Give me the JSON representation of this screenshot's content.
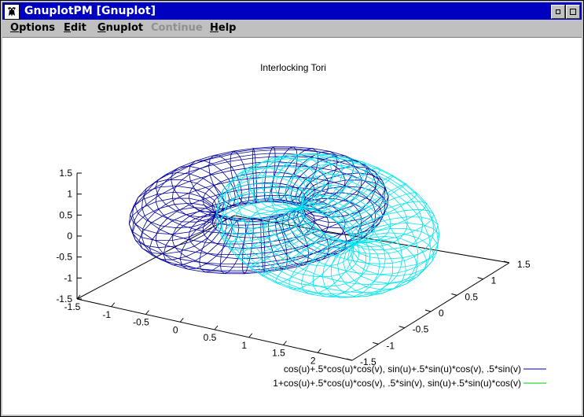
{
  "window": {
    "title": "GnuplotPM [Gnuplot]"
  },
  "menu": {
    "items": [
      {
        "first": "O",
        "rest": "ptions",
        "enabled": true
      },
      {
        "first": "E",
        "rest": "dit",
        "enabled": true
      },
      {
        "first": "G",
        "rest": "nuplot",
        "enabled": true
      },
      {
        "first": "",
        "rest": "Continue",
        "enabled": false
      },
      {
        "first": "H",
        "rest": "elp",
        "enabled": true
      }
    ]
  },
  "colors": {
    "series1": "#000099",
    "series2": "#00e5ee",
    "legend2": "#00cc00"
  },
  "chart_data": {
    "type": "surface3d",
    "title": "Interlocking Tori",
    "z_ticks": [
      "1.5",
      "1",
      "0.5",
      "0",
      "-0.5",
      "-1",
      "-1.5"
    ],
    "x_ticks": [
      "-1.5",
      "-1",
      "-0.5",
      "0",
      "0.5",
      "1",
      "1.5",
      "2"
    ],
    "y_ticks": [
      "-1.5",
      "-1",
      "-0.5",
      "0",
      "0.5",
      "1",
      "1.5"
    ],
    "xlim": [
      -1.5,
      2.5
    ],
    "ylim": [
      -1.5,
      1.5
    ],
    "zlim": [
      -1.5,
      1.5
    ],
    "series": [
      {
        "name": "cos(u)+.5*cos(u)*cos(v), sin(u)+.5*sin(u)*cos(v), .5*sin(v)",
        "line_color": "#000099"
      },
      {
        "name": "1+cos(u)+.5*cos(u)*cos(v), .5*sin(v), sin(u)+.5*sin(u)*cos(v)",
        "line_color": "#00cc00"
      }
    ]
  }
}
